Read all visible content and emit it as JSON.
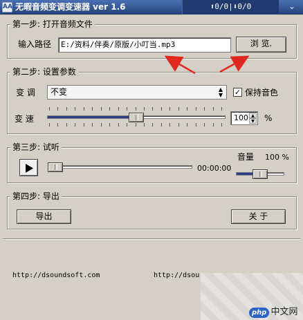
{
  "window": {
    "title": "无暇音频变调变速器 ver 1.6",
    "counter": "⬆0/0|⬇0/0",
    "close_glyph": "⌄"
  },
  "step1": {
    "legend": "第一步: 打开音频文件",
    "path_label": "输入路径",
    "path_value": "E:/资料/伴奏/原版/小叮当.mp3",
    "browse_label": "浏  览."
  },
  "step2": {
    "legend": "第二步: 设置参数",
    "pitch_label": "变 调",
    "pitch_value": "不变",
    "keep_timbre_label": "保持音色",
    "keep_timbre_checked": true,
    "speed_label": "变 速",
    "speed_value": "100",
    "speed_unit": "%",
    "speed_slider_fraction": 0.5
  },
  "step3": {
    "legend": "第三步: 试听",
    "time": "00:00:00",
    "volume_label": "音量",
    "volume_value": "100 %",
    "progress_fraction": 0.0,
    "volume_fraction": 0.5
  },
  "step4": {
    "legend": "第四步: 导出",
    "export_label": "导出",
    "about_label": "关  于"
  },
  "footer": {
    "link_left": "http://dsoundsoft.com",
    "link_right": "http://dsou"
  },
  "watermark": {
    "badge": "php",
    "text": "中文网"
  },
  "colors": {
    "titlebar": "#26457e",
    "slider_fill": "#2a3f86",
    "arrow": "#e0281e",
    "face": "#d4d0c8"
  }
}
